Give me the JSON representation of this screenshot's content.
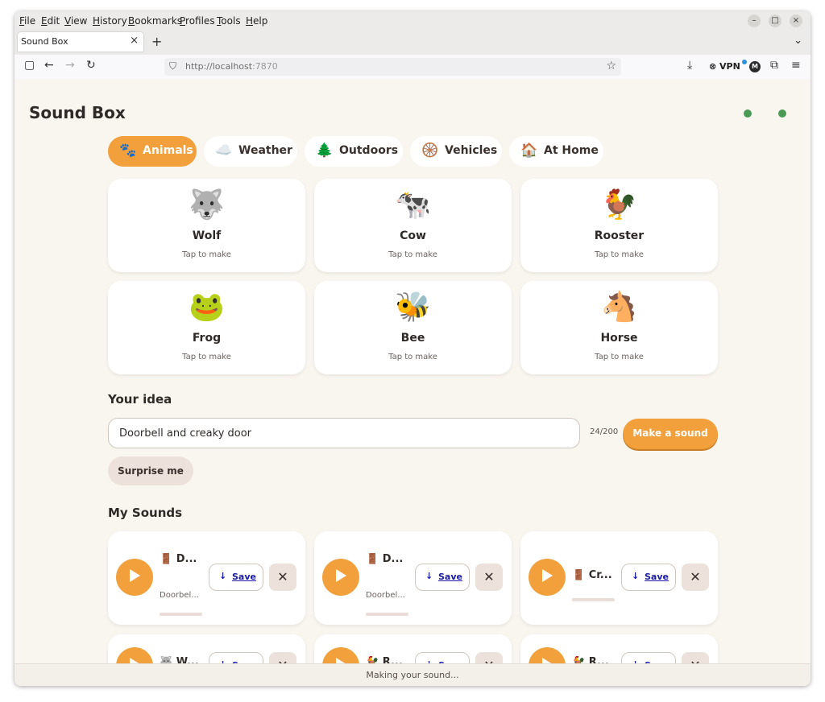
{
  "browser": {
    "menu": [
      "File",
      "Edit",
      "View",
      "History",
      "Bookmarks",
      "Profiles",
      "Tools",
      "Help"
    ],
    "tab_title": "Sound Box",
    "url_host": "http://localhost",
    "url_port": ":7870",
    "vpn_label": "VPN",
    "account_initial": "M"
  },
  "app": {
    "title": "Sound Box",
    "status_color": "#4a9a55",
    "accent_color": "#f2a03c"
  },
  "categories": [
    {
      "emoji": "🐾",
      "label": "Animals",
      "active": true
    },
    {
      "emoji": "☁️",
      "label": "Weather"
    },
    {
      "emoji": "🌲",
      "label": "Outdoors"
    },
    {
      "emoji": "🛞",
      "label": "Vehicles"
    },
    {
      "emoji": "🏠",
      "label": "At Home"
    }
  ],
  "sound_cards": [
    {
      "emoji": "🐺",
      "name": "Wolf",
      "sub": "Tap to make"
    },
    {
      "emoji": "🐄",
      "name": "Cow",
      "sub": "Tap to make"
    },
    {
      "emoji": "🐓",
      "name": "Rooster",
      "sub": "Tap to make"
    },
    {
      "emoji": "🐸",
      "name": "Frog",
      "sub": "Tap to make"
    },
    {
      "emoji": "🐝",
      "name": "Bee",
      "sub": "Tap to make"
    },
    {
      "emoji": "🐴",
      "name": "Horse",
      "sub": "Tap to make"
    }
  ],
  "idea": {
    "heading": "Your idea",
    "value": "Doorbell and creaky door",
    "counter": "24/200",
    "make_label": "Make a sound",
    "surprise_label": "Surprise me"
  },
  "my_sounds": {
    "heading": "My Sounds",
    "save_label": "Save",
    "items": [
      {
        "title": "🚪 D...",
        "sub": "Doorbel..."
      },
      {
        "title": "🚪 D...",
        "sub": "Doorbel..."
      },
      {
        "title": "🚪 Cr..."
      },
      {
        "title": "🐺 W..."
      },
      {
        "title": "🐓 R..."
      },
      {
        "title": "🐓 R..."
      }
    ]
  },
  "status": "Making your sound..."
}
